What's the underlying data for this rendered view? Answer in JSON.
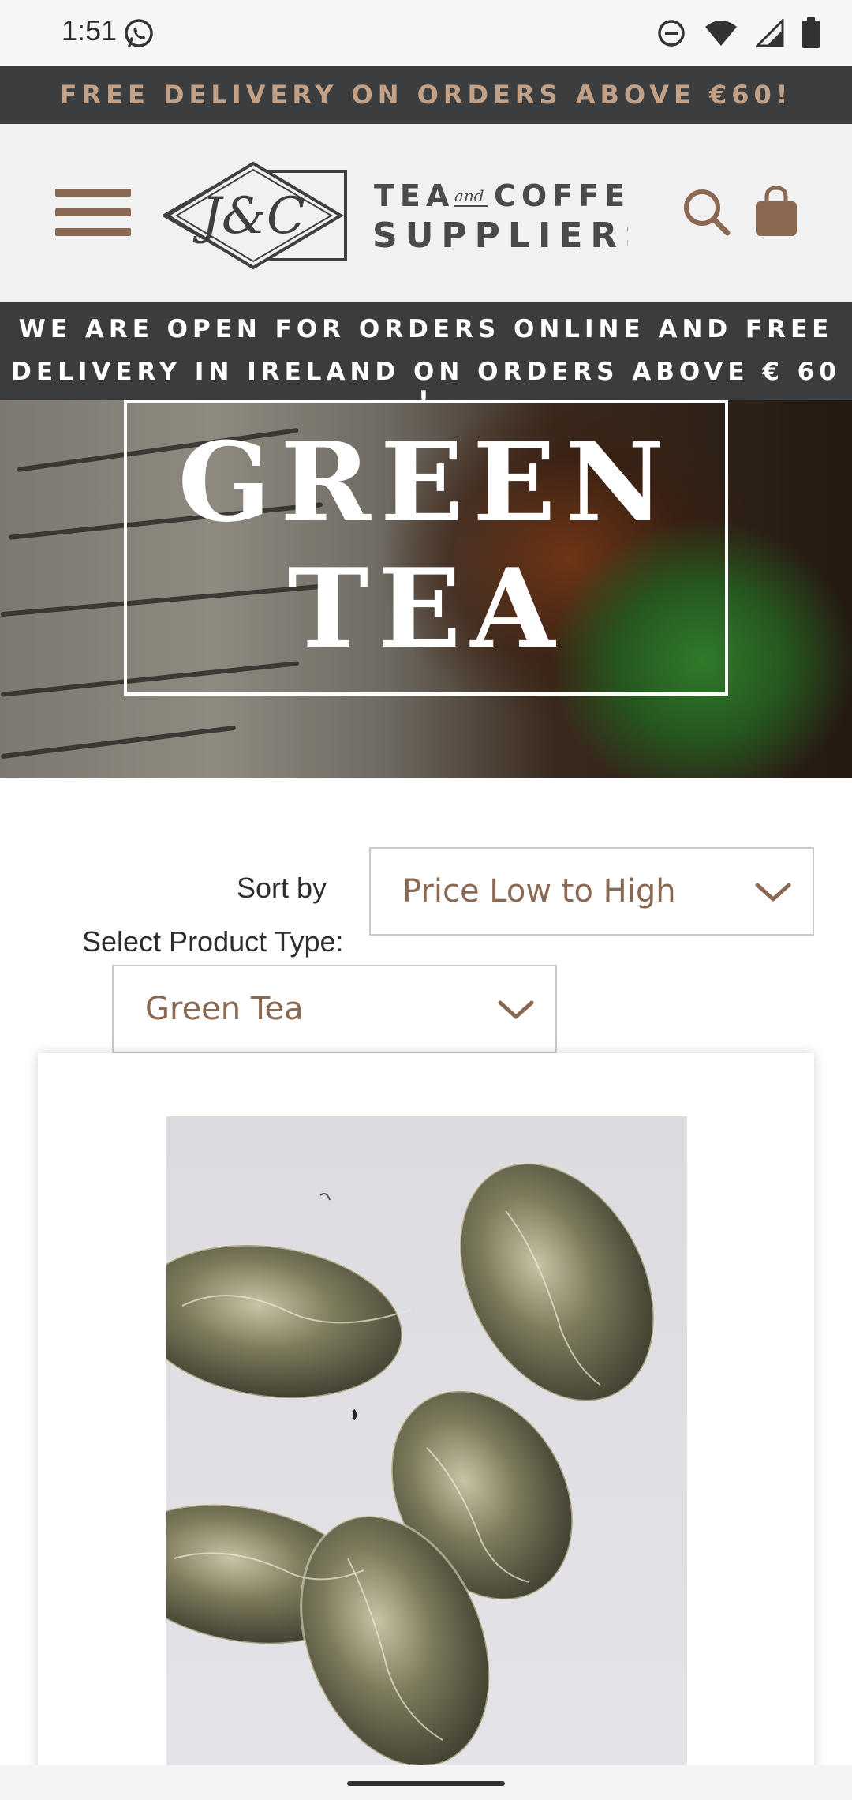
{
  "status_bar": {
    "time": "1:51",
    "icons": [
      "whatsapp-icon",
      "do-not-disturb-icon",
      "wifi-icon",
      "cell-signal-icon",
      "battery-icon"
    ]
  },
  "promo_bar": {
    "text": "FREE DELIVERY ON ORDERS ABOVE €60!"
  },
  "header": {
    "logo_monogram": "J&C",
    "logo_line1_a": "TEA",
    "logo_line1_and": "and",
    "logo_line1_b": "COFFEE",
    "logo_line2": "SUPPLIERS",
    "icons": [
      "menu-icon",
      "search-icon",
      "shopping-bag-icon"
    ]
  },
  "notice": {
    "line1": "WE ARE OPEN FOR ORDERS ONLINE AND FREE",
    "line2": "DELIVERY IN IRELAND ON ORDERS ABOVE € 60 !"
  },
  "hero": {
    "title_line1": "GREEN",
    "title_line2": "TEA"
  },
  "filters": {
    "sort_label": "Sort by",
    "sort_value": "Price Low to High",
    "type_label": "Select Product Type:",
    "type_value": "Green Tea"
  },
  "product": {
    "image_icon": "tea-pearls-photo"
  },
  "colors": {
    "accent_brown": "#8a6852",
    "promo_text": "#c2a187",
    "dark_bar": "#3c3d3e"
  }
}
